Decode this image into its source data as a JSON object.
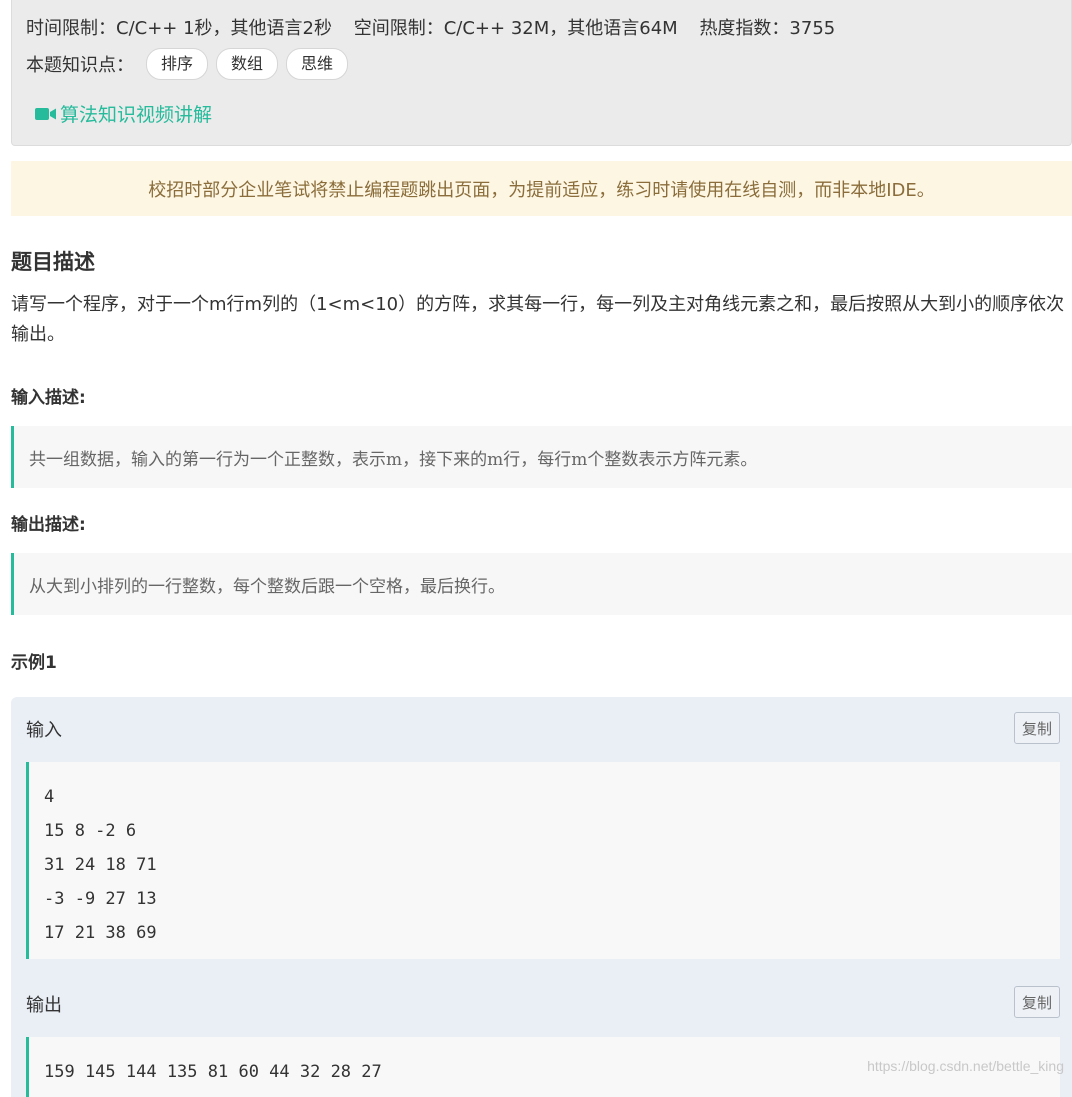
{
  "limits": {
    "time": "时间限制：C/C++ 1秒，其他语言2秒",
    "space": "空间限制：C/C++ 32M，其他语言64M",
    "heat": "热度指数：3755"
  },
  "knowledge": {
    "label": "本题知识点：",
    "tags": [
      "排序",
      "数组",
      "思维"
    ]
  },
  "video_link": {
    "icon": "video-camera-icon",
    "label": "算法知识视频讲解"
  },
  "notice": "校招时部分企业笔试将禁止编程题跳出页面，为提前适应，练习时请使用在线自测，而非本地IDE。",
  "problem": {
    "title": "题目描述",
    "description": "请写一个程序，对于一个m行m列的（1<m<10）的方阵，求其每一行，每一列及主对角线元素之和，最后按照从大到小的顺序依次输出。"
  },
  "input_desc": {
    "title": "输入描述:",
    "text": "共一组数据，输入的第一行为一个正整数，表示m，接下来的m行，每行m个整数表示方阵元素。"
  },
  "output_desc": {
    "title": "输出描述:",
    "text": "从大到小排列的一行整数，每个整数后跟一个空格，最后换行。"
  },
  "example": {
    "title": "示例1",
    "input_label": "输入",
    "output_label": "输出",
    "copy_label": "复制",
    "input_lines": [
      "4",
      "15 8 -2 6",
      "31 24 18 71",
      "-3 -9 27 13",
      "17 21 38 69"
    ],
    "output_lines": [
      "159 145 144 135 81 60 44 32 28 27"
    ]
  },
  "watermark": "https://blog.csdn.net/bettle_king",
  "colors": {
    "accent": "#25bb9b",
    "notice_bg": "#fdf6e3",
    "notice_text": "#8a6d3b"
  }
}
